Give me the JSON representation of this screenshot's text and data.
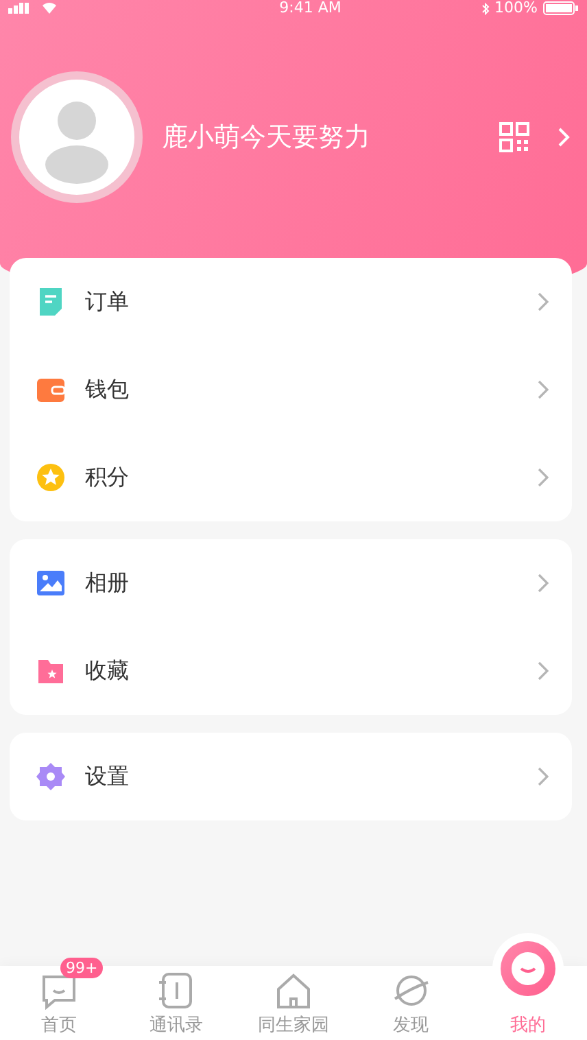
{
  "status_bar": {
    "time": "9:41 AM",
    "battery": "100%"
  },
  "profile": {
    "name": "鹿小萌今天要努力"
  },
  "menu_groups": [
    {
      "items": [
        {
          "kind": "order",
          "label": "订单"
        },
        {
          "kind": "wallet",
          "label": "钱包"
        },
        {
          "kind": "points",
          "label": "积分"
        }
      ]
    },
    {
      "items": [
        {
          "kind": "album",
          "label": "相册"
        },
        {
          "kind": "favorites",
          "label": "收藏"
        }
      ]
    },
    {
      "items": [
        {
          "kind": "settings",
          "label": "设置"
        }
      ]
    }
  ],
  "tab_bar": [
    {
      "kind": "home",
      "label": "首页",
      "badge": "99+",
      "selected": false
    },
    {
      "kind": "contacts",
      "label": "通讯录",
      "selected": false
    },
    {
      "kind": "house",
      "label": "同生家园",
      "selected": false
    },
    {
      "kind": "discover",
      "label": "发现",
      "selected": false
    },
    {
      "kind": "me",
      "label": "我的",
      "selected": true
    }
  ]
}
